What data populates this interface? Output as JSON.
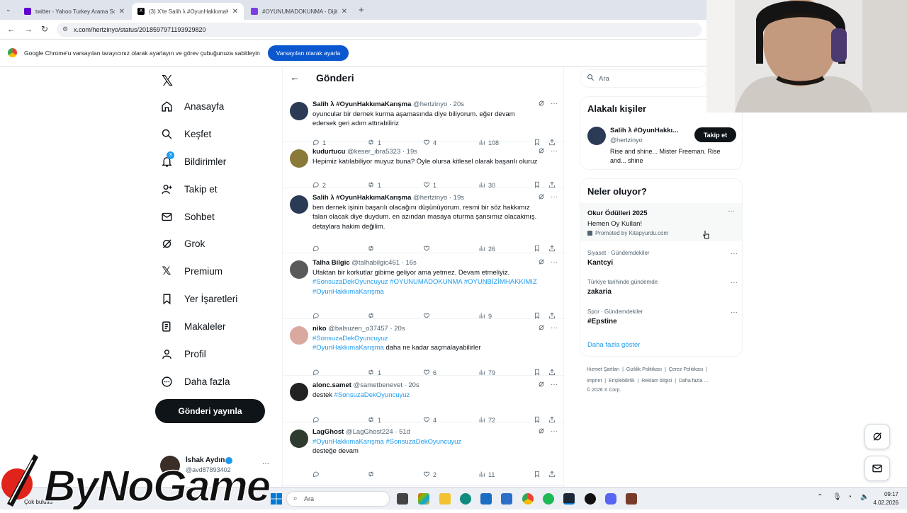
{
  "browser": {
    "tabs": [
      {
        "title": "twitter - Yahoo Turkey Arama So",
        "icon": "yahoo-icon",
        "color": "#6001d2"
      },
      {
        "title": "(3) X'te Salih λ #OyunHakkımaK",
        "icon": "x-icon",
        "color": "#000000"
      },
      {
        "title": "#OYUNUMADOKUNMA - Dijital",
        "icon": "gamepad-icon",
        "color": "#7b3fe4"
      }
    ],
    "new_tab": "+",
    "url": "x.com/hertzinyo/status/2018597971193929820",
    "infobar_message": "Google Chrome'u varsayılan tarayıcınız olarak ayarlayın ve görev çubuğunuza sabitleyin",
    "infobar_button": "Varsayılan olarak ayarla"
  },
  "sidebar": {
    "items": [
      {
        "label": "Anasayfa",
        "icon": "home-icon"
      },
      {
        "label": "Keşfet",
        "icon": "search-icon"
      },
      {
        "label": "Bildirimler",
        "icon": "bell-icon",
        "badge": "3"
      },
      {
        "label": "Takip et",
        "icon": "follow-icon"
      },
      {
        "label": "Sohbet",
        "icon": "mail-icon"
      },
      {
        "label": "Grok",
        "icon": "grok-icon"
      },
      {
        "label": "Premium",
        "icon": "x-icon"
      },
      {
        "label": "Yer İşaretleri",
        "icon": "bookmark-icon"
      },
      {
        "label": "Makaleler",
        "icon": "article-icon"
      },
      {
        "label": "Profil",
        "icon": "profile-icon"
      },
      {
        "label": "Daha fazla",
        "icon": "more-icon"
      }
    ],
    "post_button": "Gönderi yayınla",
    "account": {
      "name": "İshak Aydın",
      "handle": "@avd87893402",
      "more": "···"
    }
  },
  "main": {
    "title": "Gönderi",
    "tweets": [
      {
        "name": "Salih λ #OyunHakkımaKarışma",
        "meta": "@hertzinyo · 20s",
        "avatar_color": "#2b3a55",
        "text": [
          [
            "t",
            "oyuncular bir dernek kurma aşamasında diye biliyorum. eğer devam edersek geri adım attırabiliriz"
          ]
        ],
        "replies": "1",
        "reposts": "1",
        "likes": "4",
        "views": "108"
      },
      {
        "name": "kudurtucu",
        "meta": "@keser_ibra5323 · 19s",
        "avatar_color": "#8a7a3a",
        "text": [
          [
            "t",
            "Hepimiz katılabiliyor muyuz buna? Öyle olursa kitlesel olarak başarılı oluruz"
          ]
        ],
        "replies": "2",
        "reposts": "1",
        "likes": "1",
        "views": "30"
      },
      {
        "name": "Salih λ #OyunHakkımaKarışma",
        "meta": "@hertzinyo · 19s",
        "avatar_color": "#2b3a55",
        "text": [
          [
            "t",
            "ben dernek işinin başarılı olacağını düşünüyorum. resmi bir söz hakkımız falan olacak diye duydum. en azından masaya oturma şansımız olacakmış. detaylara hakim değilim."
          ]
        ],
        "replies": "",
        "reposts": "",
        "likes": "",
        "views": "26"
      },
      {
        "name": "Talha Bilgic",
        "meta": "@talhabilgic461 · 16s",
        "avatar_color": "#5a5a5a",
        "text": [
          [
            "t",
            "Ufaktan bir korkutlar gibime geliyor ama yetmez. Devam etmeliyiz. "
          ],
          [
            "h",
            "#SonsuzaDekOyuncuyuz #OYUNUMADOKUNMA #OYUNBİZİMHAKKIMIZ #OyunHakkımaKarışma"
          ]
        ],
        "replies": "",
        "reposts": "",
        "likes": "",
        "views": "9"
      },
      {
        "name": "niko",
        "meta": "@balsuzen_o37457 · 20s",
        "avatar_color": "#d9a9a0",
        "text": [
          [
            "h",
            "#SonsuzaDekOyuncuyuz"
          ],
          [
            "br",
            ""
          ],
          [
            "h",
            "#OyunHakkımaKarışma"
          ],
          [
            "t",
            " daha ne kadar saçmalayabilirler"
          ]
        ],
        "replies": "",
        "reposts": "1",
        "likes": "6",
        "views": "79"
      },
      {
        "name": "alonc.samet",
        "meta": "@sametbenevet · 20s",
        "avatar_color": "#222222",
        "text": [
          [
            "t",
            "destek "
          ],
          [
            "h",
            "#SonsuzaDekOyuncuyuz"
          ]
        ],
        "replies": "",
        "reposts": "1",
        "likes": "4",
        "views": "72"
      },
      {
        "name": "LagGhost",
        "meta": "@LagGhost224 · 51d",
        "avatar_color": "#2e3b2e",
        "text": [
          [
            "h",
            "#OyunHakkımaKarışma #SonsuzaDekOyuncuyuz"
          ],
          [
            "br",
            ""
          ],
          [
            "t",
            "desteğe devam"
          ]
        ],
        "replies": "",
        "reposts": "",
        "likes": "2",
        "views": "11"
      }
    ]
  },
  "right": {
    "search_placeholder": "Ara",
    "related_title": "Alakalı kişiler",
    "related_person": {
      "name": "Salih λ #OyunHakkı...",
      "handle": "@hertzinyo",
      "bio": "Rise and shine... Mister Freeman. Rise and... shine",
      "follow_button": "Takip et"
    },
    "trends_title": "Neler oluyor?",
    "promo": {
      "title": "Okur Ödülleri 2025",
      "subtitle": "Hemen Oy Kullan!",
      "promoted": "Promoted by Kitapyurdu.com"
    },
    "trends": [
      {
        "category": "Siyaset · Gündemdekiler",
        "name": "Kantcyi"
      },
      {
        "category": "Türkiye tarihinde gündemde",
        "name": "zakaria"
      },
      {
        "category": "Spor · Gündemdekiler",
        "name": "#Epstine"
      }
    ],
    "show_more": "Daha fazla göster",
    "footer_line1": [
      "Hizmet Şartları",
      "Gizlilik Politikası",
      "Çerez Politikası"
    ],
    "footer_line2": [
      "Imprint",
      "Erişilebilirlik",
      "Reklam bilgisi",
      "Daha fazla ..."
    ],
    "copyright": "© 2026 X Corp."
  },
  "taskbar": {
    "weather": "Çok bulutlu",
    "search_placeholder": "Ara",
    "time": "09:17",
    "date": "4.02.2026"
  },
  "watermark": "ByNoGame"
}
